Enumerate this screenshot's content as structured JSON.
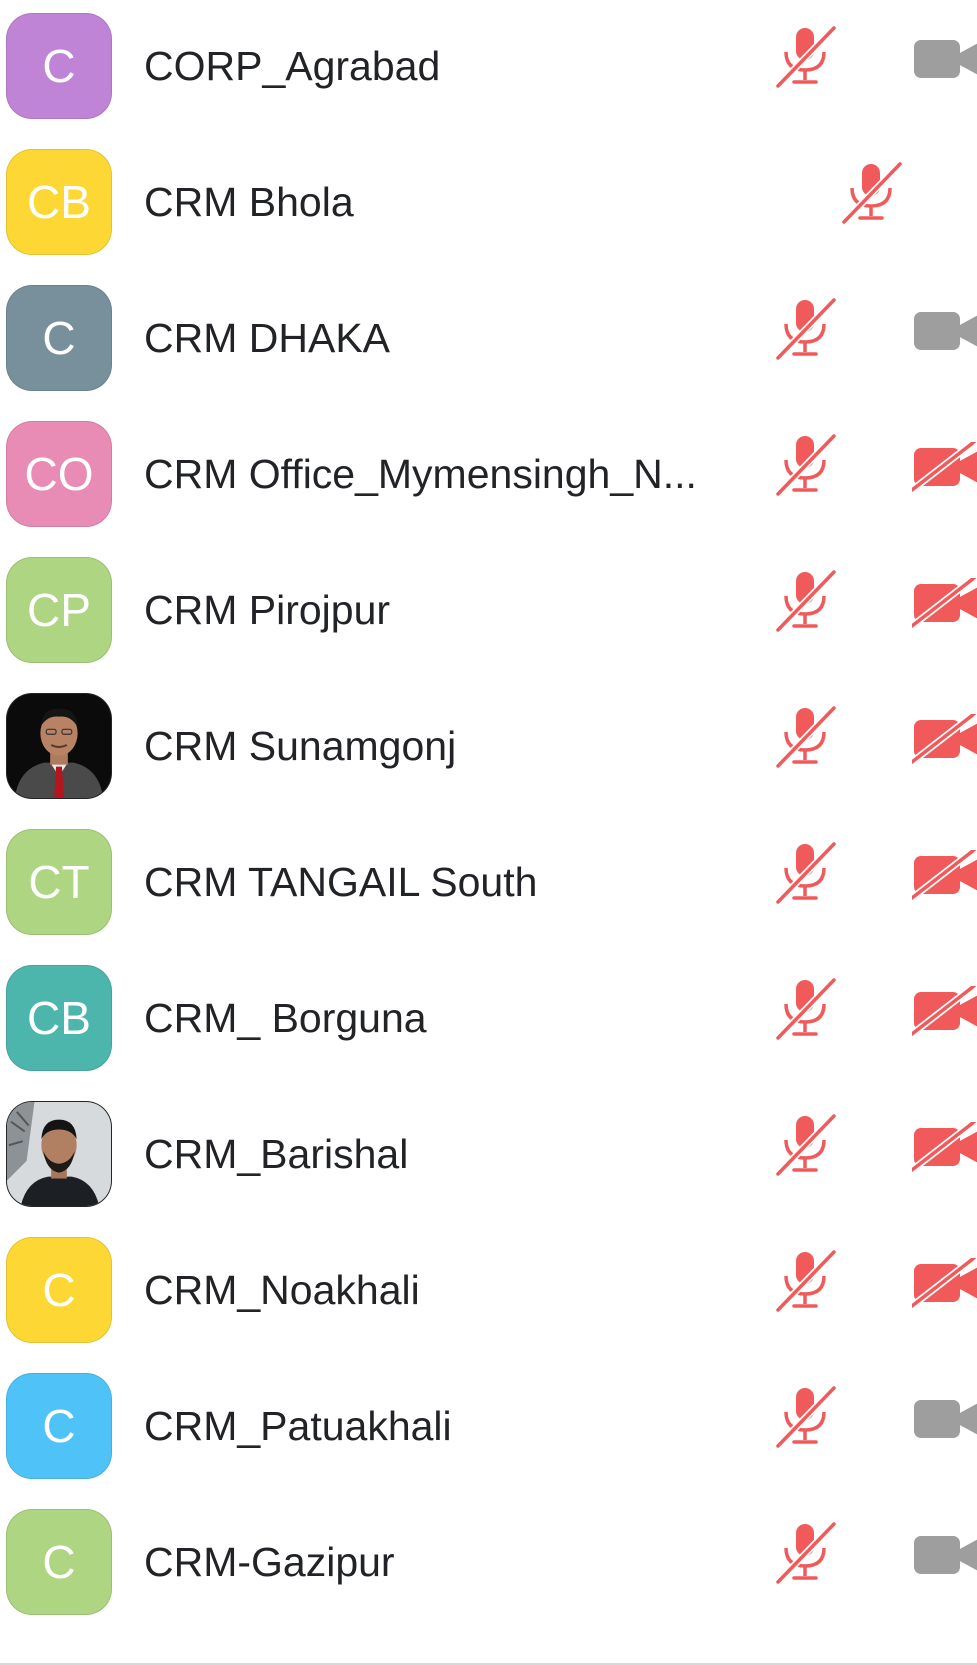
{
  "participants": [
    {
      "name": "CORP_Agrabad",
      "initials": "C",
      "avatar_color": "#c084d6",
      "avatar_type": "initials",
      "mic": "muted",
      "camera": "off"
    },
    {
      "name": "CRM Bhola",
      "initials": "CB",
      "avatar_color": "#fdd835",
      "avatar_type": "initials",
      "mic": "muted",
      "camera": "none"
    },
    {
      "name": "CRM DHAKA",
      "initials": "C",
      "avatar_color": "#78909c",
      "avatar_type": "initials",
      "mic": "muted",
      "camera": "off"
    },
    {
      "name": "CRM Office_Mymensingh_N...",
      "initials": "CO",
      "avatar_color": "#e88cb5",
      "avatar_type": "initials",
      "mic": "muted",
      "camera": "blocked"
    },
    {
      "name": "CRM Pirojpur",
      "initials": "CP",
      "avatar_color": "#aed581",
      "avatar_type": "initials",
      "mic": "muted",
      "camera": "blocked"
    },
    {
      "name": "CRM Sunamgonj",
      "initials": "",
      "avatar_color": "#111111",
      "avatar_type": "photo",
      "mic": "muted",
      "camera": "blocked"
    },
    {
      "name": "CRM TANGAIL South",
      "initials": "CT",
      "avatar_color": "#aed581",
      "avatar_type": "initials",
      "mic": "muted",
      "camera": "blocked"
    },
    {
      "name": "CRM_ Borguna",
      "initials": "CB",
      "avatar_color": "#4db6ac",
      "avatar_type": "initials",
      "mic": "muted",
      "camera": "blocked"
    },
    {
      "name": "CRM_Barishal",
      "initials": "",
      "avatar_color": "#cfd3d6",
      "avatar_type": "photo",
      "mic": "muted",
      "camera": "blocked"
    },
    {
      "name": "CRM_Noakhali",
      "initials": "C",
      "avatar_color": "#fdd835",
      "avatar_type": "initials",
      "mic": "muted",
      "camera": "blocked"
    },
    {
      "name": "CRM_Patuakhali",
      "initials": "C",
      "avatar_color": "#4fc3f7",
      "avatar_type": "initials",
      "mic": "muted",
      "camera": "off"
    },
    {
      "name": "CRM-Gazipur",
      "initials": "C",
      "avatar_color": "#aed581",
      "avatar_type": "initials",
      "mic": "muted",
      "camera": "off"
    }
  ],
  "icons": {
    "mic_muted": "mic-muted-icon",
    "camera_off": "video-camera-icon",
    "camera_blocked": "video-camera-off-icon"
  },
  "colors": {
    "muted_red": "#f15a5a",
    "camera_gray": "#9e9e9e",
    "name_text": "#222327"
  }
}
